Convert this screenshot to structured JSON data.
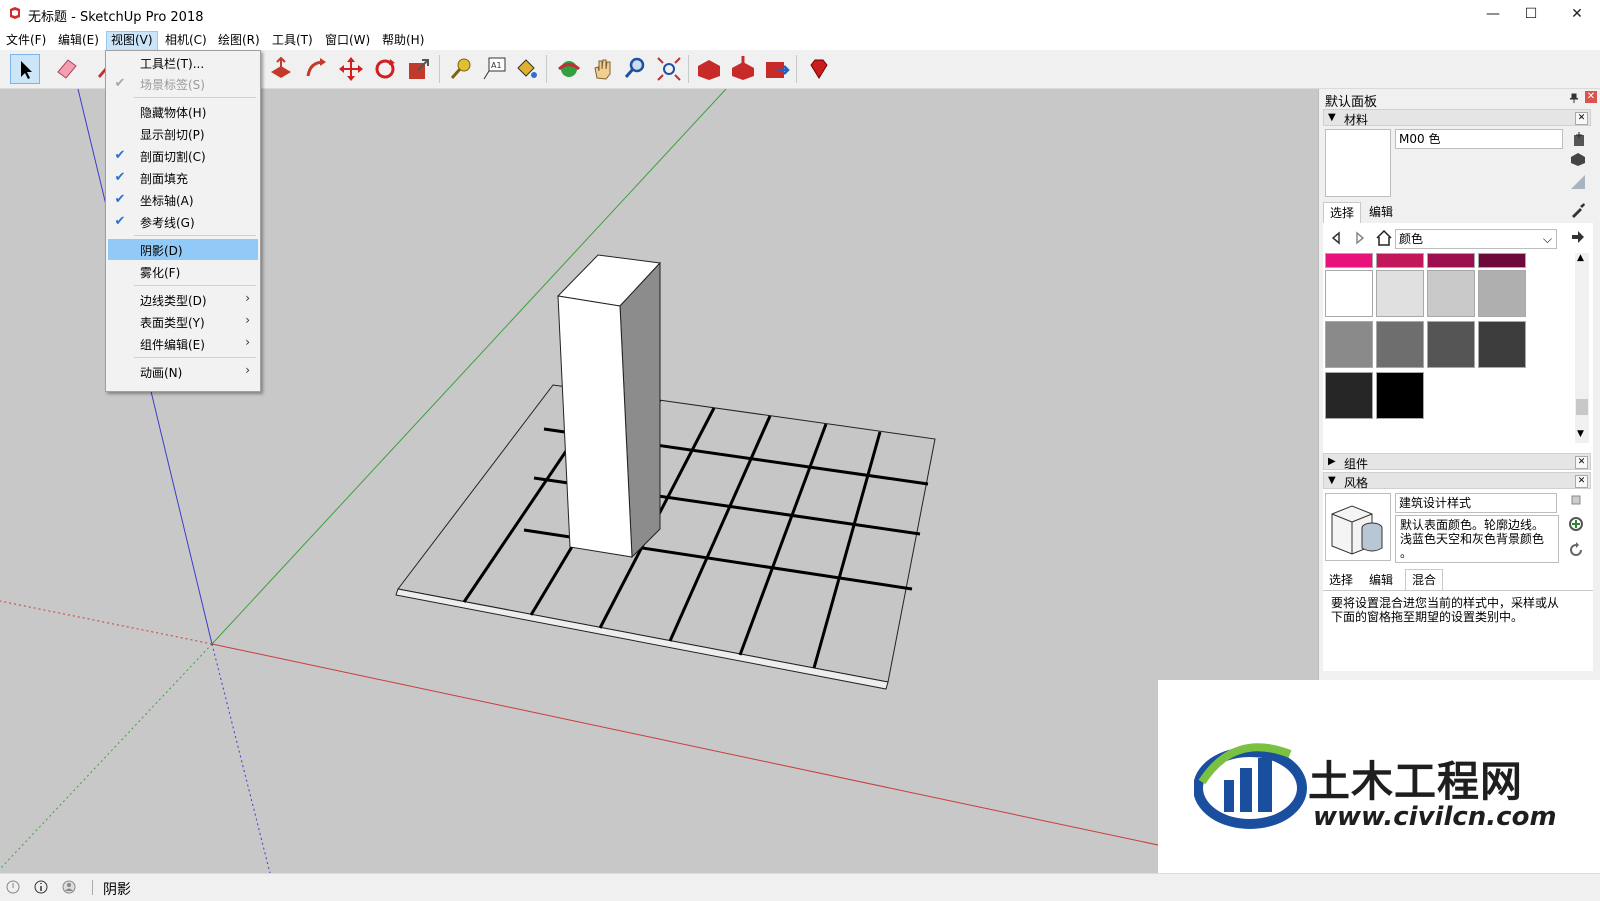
{
  "window": {
    "title": "无标题 - SketchUp Pro 2018",
    "minimize": "—",
    "maximize": "☐",
    "close": "✕"
  },
  "menubar": {
    "items": [
      {
        "label": "文件(F)"
      },
      {
        "label": "编辑(E)"
      },
      {
        "label": "视图(V)"
      },
      {
        "label": "相机(C)"
      },
      {
        "label": "绘图(R)"
      },
      {
        "label": "工具(T)"
      },
      {
        "label": "窗口(W)"
      },
      {
        "label": "帮助(H)"
      }
    ]
  },
  "view_menu": {
    "items": [
      {
        "label": "工具栏(T)...",
        "checked": false,
        "disabled": false
      },
      {
        "label": "场景标签(S)",
        "checked": true,
        "disabled": true
      },
      {
        "label": "隐藏物体(H)",
        "checked": false,
        "disabled": false
      },
      {
        "label": "显示剖切(P)",
        "checked": false,
        "disabled": false
      },
      {
        "label": "剖面切割(C)",
        "checked": true,
        "disabled": false
      },
      {
        "label": "剖面填充",
        "checked": true,
        "disabled": false
      },
      {
        "label": "坐标轴(A)",
        "checked": true,
        "disabled": false
      },
      {
        "label": "参考线(G)",
        "checked": true,
        "disabled": false
      },
      {
        "label": "阴影(D)",
        "checked": false,
        "disabled": false,
        "highlight": true
      },
      {
        "label": "雾化(F)",
        "checked": false,
        "disabled": false
      },
      {
        "label": "边线类型(D)",
        "submenu": true
      },
      {
        "label": "表面类型(Y)",
        "submenu": true
      },
      {
        "label": "组件编辑(E)",
        "submenu": true
      },
      {
        "label": "动画(N)",
        "submenu": true
      }
    ]
  },
  "tray": {
    "title": "默认面板",
    "materials": {
      "header": "材料",
      "name_value": "M00 色",
      "tabs": [
        "选择",
        "编辑"
      ],
      "category": "颜色",
      "swatch_colors_top": [
        "#e8127a",
        "#c2185b",
        "#9c1050",
        "#6d0a3a"
      ],
      "swatch_colors": [
        "#ffffff",
        "#e0e0e0",
        "#c9c9c9",
        "#afafaf",
        "#8a8a8a",
        "#6e6e6e",
        "#555555",
        "#3c3c3c",
        "#262626",
        "#000000"
      ]
    },
    "components": {
      "header": "组件"
    },
    "styles": {
      "header": "风格",
      "style_name": "建筑设计样式",
      "style_desc_1": "默认表面颜色。轮廓边线。",
      "style_desc_2": "浅蓝色天空和灰色背景颜色",
      "style_desc_3": "。",
      "tabs": [
        "选择",
        "编辑",
        "混合"
      ],
      "mix_desc_1": "要将设置混合进您当前的样式中，采样或从",
      "mix_desc_2": "下面的窗格拖至期望的设置类别中。"
    }
  },
  "status": {
    "text": "阴影"
  },
  "watermark": {
    "title": "土木工程网",
    "url": "www.civilcn.com"
  },
  "colors": {
    "viewport_bg": "#c8c8c8",
    "axis_red": "#c83c3c",
    "axis_green": "#3ca03c",
    "axis_blue": "#3c3cc8",
    "menu_highlight": "#91c9f7"
  }
}
